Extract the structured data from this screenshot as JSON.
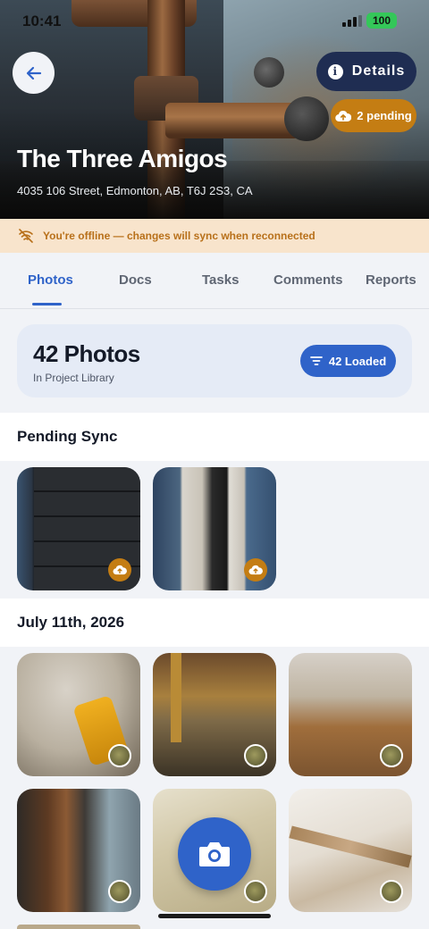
{
  "status_bar": {
    "time": "10:41",
    "battery": "100"
  },
  "header": {
    "title": "The Three Amigos",
    "address": "4035 106 Street, Edmonton, AB, T6J 2S3, CA",
    "details_label": "Details",
    "pending_label": "2 pending"
  },
  "offline_banner": {
    "text": "You're offline — changes will sync when reconnected"
  },
  "tabs": [
    {
      "label": "Photos",
      "active": true
    },
    {
      "label": "Docs",
      "active": false
    },
    {
      "label": "Tasks",
      "active": false
    },
    {
      "label": "Comments",
      "active": false
    },
    {
      "label": "Reports",
      "active": false
    }
  ],
  "summary": {
    "count": "42 Photos",
    "library": "In Project Library",
    "loaded_label": "42 Loaded"
  },
  "sections": {
    "pending": {
      "title": "Pending Sync",
      "photos": [
        "dark siding panel",
        "window frame"
      ]
    },
    "dated": {
      "title": "July 11th, 2026",
      "photos": [
        "moisture meter on moldy wall",
        "flooded basement",
        "wet wood floor",
        "rusty pipe valve",
        "water-damaged ceiling corner",
        "damaged trim"
      ]
    }
  },
  "colors": {
    "primary": "#2f63c9",
    "pending": "#c47d13",
    "navy": "#1f2d52",
    "offline_bg": "#f8e4cc",
    "offline_text": "#b8701a"
  }
}
